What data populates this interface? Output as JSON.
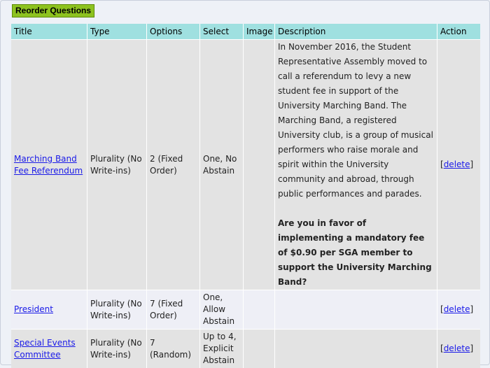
{
  "toolbar": {
    "reorder_label": "Reorder Questions"
  },
  "table": {
    "headers": [
      "Title",
      "Type",
      "Options",
      "Select",
      "Image",
      "Description",
      "Action"
    ],
    "rows": [
      {
        "title": "Marching Band Fee Referendum",
        "type": "Plurality (No Write-ins)",
        "options": "2 (Fixed Order)",
        "select": "One, No Abstain",
        "image": "",
        "description": "In November 2016, the Student Representative Assembly moved to call a referendum to levy a new student fee in support of the University Marching Band. The Marching Band, a registered University club, is a group of musical performers who raise morale and spirit within the University community and abroad, through public performances and parades.",
        "question": "Are you in favor of implementing a mandatory fee of $0.90 per SGA member to support the University Marching Band?",
        "action": "delete"
      },
      {
        "title": "President",
        "type": "Plurality (No Write-ins)",
        "options": "7 (Fixed Order)",
        "select": "One, Allow Abstain",
        "image": "",
        "description": "",
        "action": "delete"
      },
      {
        "title": "Special Events Committee",
        "type": "Plurality (No Write-ins)",
        "options": "7 (Random)",
        "select": "Up to 4, Explicit Abstain",
        "image": "",
        "description": "",
        "action": "delete"
      }
    ]
  }
}
